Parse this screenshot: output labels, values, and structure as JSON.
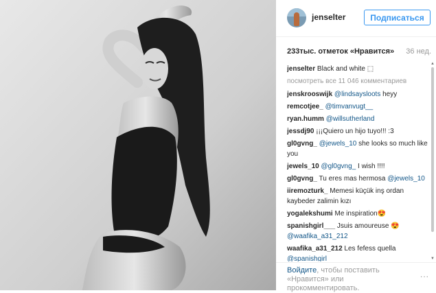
{
  "header": {
    "username": "jenselter",
    "follow_label": "Подписаться"
  },
  "stats": {
    "likes": "233тыс. отметок «Нравится»",
    "age": "36 нед."
  },
  "caption": {
    "user": "jenselter",
    "text": "Black and white ⬚"
  },
  "view_all": "посмотреть все 11 046 комментариев",
  "comments": [
    {
      "user": "jenskrooswijk",
      "mention": "@lindsaysloots",
      "text": " heyy"
    },
    {
      "user": "remcotjee_",
      "mention": "@timvanvugt__",
      "text": ""
    },
    {
      "user": "ryan.humm",
      "mention": "@willsutherland",
      "text": ""
    },
    {
      "user": "jessdj90",
      "mention": "",
      "text": "¡¡¡Quiero un hijo tuyo!!! :3"
    },
    {
      "user": "gl0gvng_",
      "mention": "@jewels_10",
      "text": " she looks so much like you"
    },
    {
      "user": "jewels_10",
      "mention": "@gl0gvng_",
      "text": " I wish !!!!"
    },
    {
      "user": "gl0gvng_",
      "mention": "",
      "text": "Tu eres mas hermosa ",
      "mention2": "@jewels_10"
    },
    {
      "user": "iiremozturk_",
      "mention": "",
      "text": "Memesi küçük inş ordan kaybeder zalimin kızı"
    },
    {
      "user": "yogalekshumi",
      "mention": "",
      "text": "Me inspiration😍"
    },
    {
      "user": "spanishgirl___",
      "mention": "",
      "text": "Jsuis amoureuse 😍",
      "mention2": "@waafika_a31_212"
    },
    {
      "user": "waafika_a31_212",
      "mention": "",
      "text": "Les fefess quella ",
      "mention2": "@spanishgirl___"
    }
  ],
  "footer": {
    "login_link": "Войдите",
    "login_rest": ", чтобы поставить «Нравится» или прокомментировать.",
    "more": "..."
  }
}
